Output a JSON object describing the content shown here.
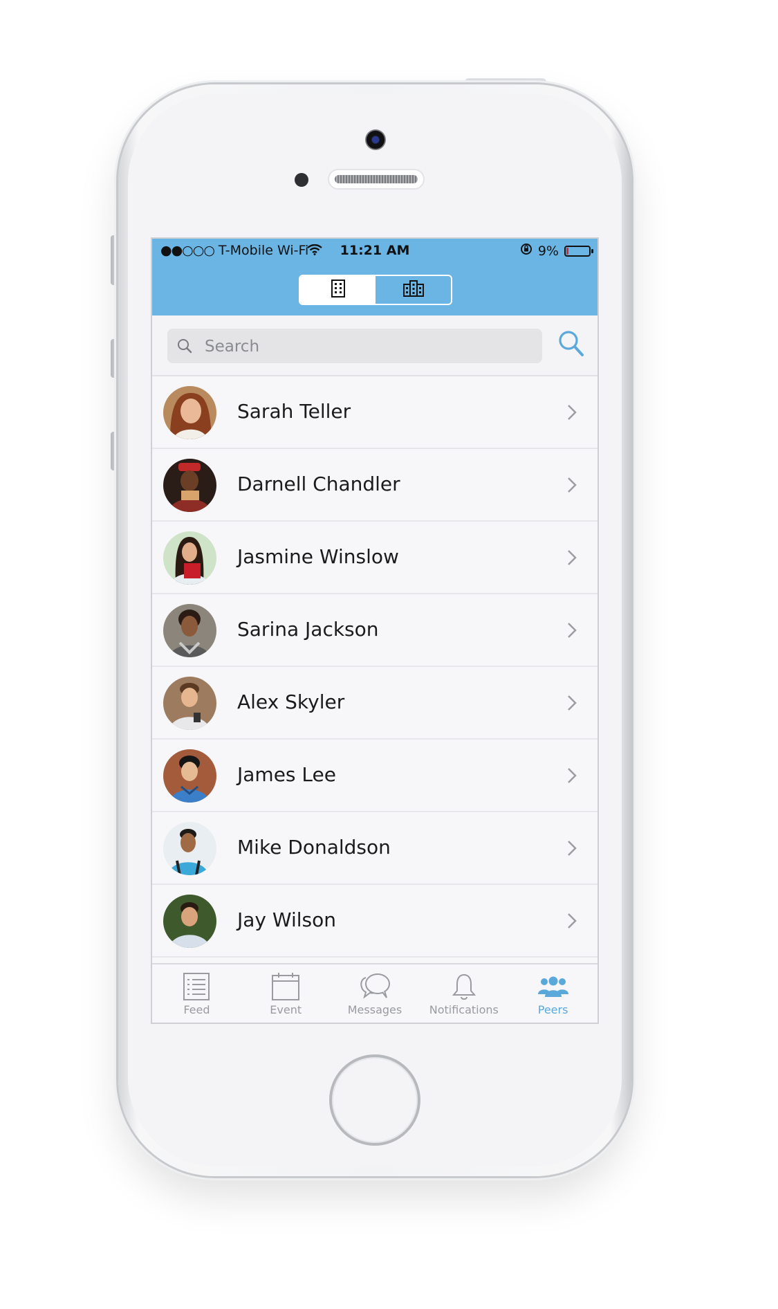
{
  "status_bar": {
    "signal": "●●○○○",
    "carrier": "T-Mobile Wi-Fi",
    "time": "11:21 AM",
    "battery_percent": "9%",
    "battery_level": 0.09,
    "battery_color": "#e0262b"
  },
  "header": {
    "color": "#6ab5e4",
    "segments": [
      {
        "icon": "building-icon",
        "selected": true
      },
      {
        "icon": "buildings-icon",
        "selected": false
      }
    ]
  },
  "search": {
    "placeholder": "Search",
    "value": "",
    "icon": "search-icon"
  },
  "peers": [
    {
      "name": "Sarah Teller"
    },
    {
      "name": "Darnell Chandler"
    },
    {
      "name": "Jasmine Winslow"
    },
    {
      "name": "Sarina Jackson"
    },
    {
      "name": "Alex Skyler"
    },
    {
      "name": "James Lee"
    },
    {
      "name": "Mike Donaldson"
    },
    {
      "name": "Jay Wilson"
    }
  ],
  "tab_bar": {
    "active_color": "#5aa9da",
    "tabs": [
      {
        "label": "Feed",
        "icon": "list-icon",
        "active": false
      },
      {
        "label": "Event",
        "icon": "calendar-icon",
        "active": false
      },
      {
        "label": "Messages",
        "icon": "chat-bubbles-icon",
        "active": false
      },
      {
        "label": "Notifications",
        "icon": "bell-icon",
        "active": false
      },
      {
        "label": "Peers",
        "icon": "people-icon",
        "active": true
      }
    ]
  }
}
